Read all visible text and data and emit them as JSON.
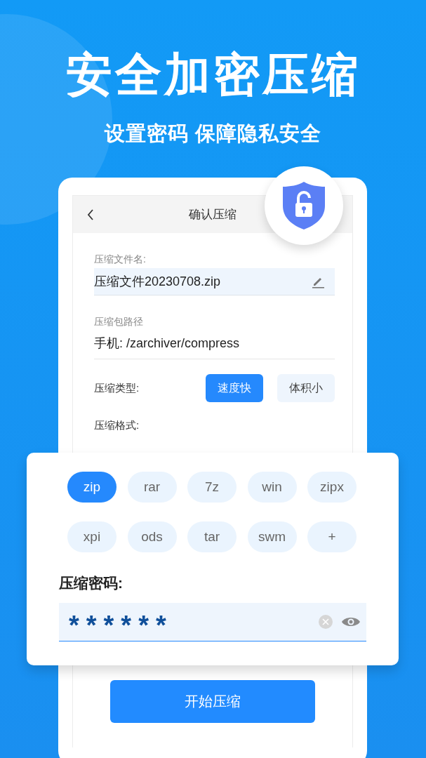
{
  "hero": {
    "title": "安全加密压缩",
    "subtitle": "设置密码 保障隐私安全"
  },
  "screen": {
    "title": "确认压缩"
  },
  "file_name": {
    "label": "压缩文件名:",
    "value": "压缩文件20230708.zip"
  },
  "path": {
    "label": "压缩包路径",
    "value": "手机: /zarchiver/compress"
  },
  "type": {
    "label": "压缩类型:",
    "options": [
      {
        "label": "速度快",
        "selected": true
      },
      {
        "label": "体积小",
        "selected": false
      }
    ]
  },
  "format": {
    "label": "压缩格式:",
    "options": [
      {
        "label": "zip",
        "selected": true
      },
      {
        "label": "rar",
        "selected": false
      },
      {
        "label": "7z",
        "selected": false
      },
      {
        "label": "win",
        "selected": false
      },
      {
        "label": "zipx",
        "selected": false
      },
      {
        "label": "xpi",
        "selected": false
      },
      {
        "label": "ods",
        "selected": false
      },
      {
        "label": "tar",
        "selected": false
      },
      {
        "label": "swm",
        "selected": false
      },
      {
        "label": "+",
        "selected": false
      }
    ]
  },
  "password": {
    "label": "压缩密码:",
    "value": "******"
  },
  "start_button": "开始压缩"
}
